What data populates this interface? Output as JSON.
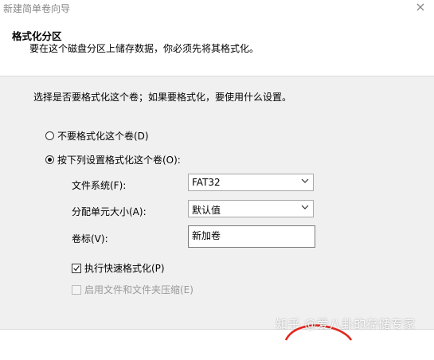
{
  "window": {
    "title": "新建简单卷向导",
    "close_glyph": "×"
  },
  "header": {
    "title": "格式化分区",
    "description": "要在这个磁盘分区上储存数据，你必须先将其格式化。"
  },
  "content": {
    "intro": "选择是否要格式化这个卷；如果要格式化，要使用什么设置。",
    "options": [
      {
        "label": "不要格式化这个卷(D)",
        "selected": false
      },
      {
        "label": "按下列设置格式化这个卷(O):",
        "selected": true
      }
    ],
    "fields": {
      "filesystem": {
        "label": "文件系统(F):",
        "value": "FAT32"
      },
      "allocation": {
        "label": "分配单元大小(A):",
        "value": "默认值"
      },
      "volume_label": {
        "label": "卷标(V):",
        "value": "新加卷"
      }
    },
    "checkboxes": [
      {
        "label": "执行快速格式化(P)",
        "checked": true,
        "enabled": true
      },
      {
        "label": "启用文件和文件夹压缩(E)",
        "checked": false,
        "enabled": false
      }
    ]
  },
  "watermark": "知乎 @爱八卦的存储专家",
  "colors": {
    "content_bg": "#f0f0f0",
    "accent_red": "#e3241b"
  },
  "icons": {
    "dropdown": "chevron-down-icon",
    "check": "checkmark-icon"
  }
}
